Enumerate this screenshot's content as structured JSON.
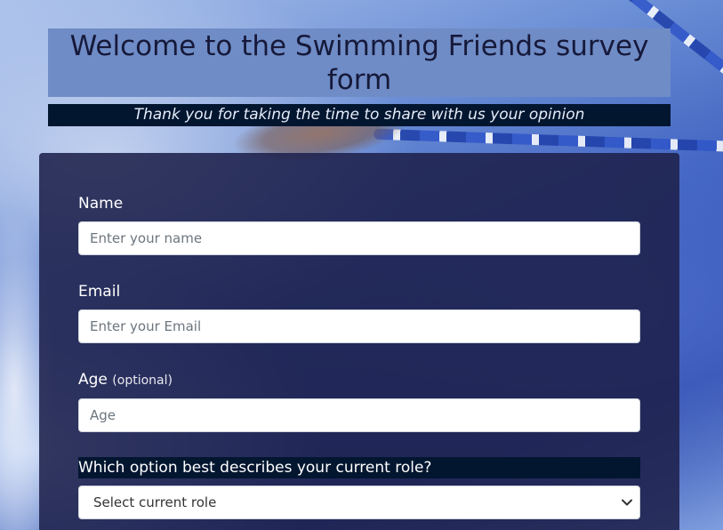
{
  "header": {
    "title": "Welcome to the Swimming Friends survey form",
    "subtitle": "Thank you for taking the time to share with us your opinion"
  },
  "form": {
    "name": {
      "label": "Name",
      "placeholder": "Enter your name",
      "value": ""
    },
    "email": {
      "label": "Email",
      "placeholder": "Enter your Email",
      "value": ""
    },
    "age": {
      "label": "Age",
      "optional_label": "(optional)",
      "placeholder": "Age",
      "value": ""
    },
    "role": {
      "label": "Which option best describes your current role?",
      "selected": "Select current role"
    }
  },
  "icons": {
    "select_chevron": "chevron-down-icon"
  },
  "colors": {
    "title_bg": "#6f8cc6",
    "subtitle_bg": "#021630",
    "panel_bg": "#1e214b",
    "title_text": "#16193a"
  }
}
